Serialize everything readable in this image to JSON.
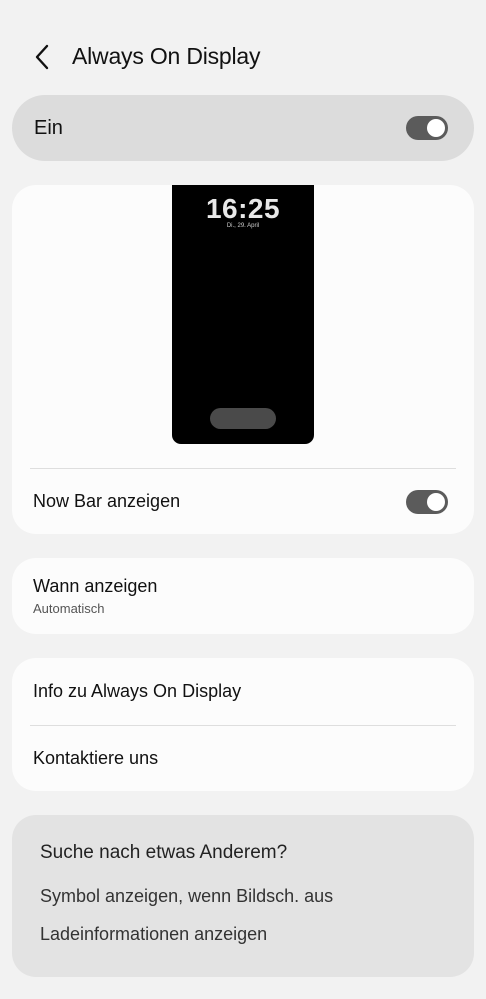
{
  "header": {
    "title": "Always On Display",
    "back_icon": "chevron-left-icon"
  },
  "master_switch": {
    "label": "Ein",
    "state": "on"
  },
  "preview": {
    "time": "16:25",
    "date": "Di., 29. April"
  },
  "now_bar": {
    "label": "Now Bar anzeigen",
    "state": "on"
  },
  "when_show": {
    "label": "Wann anzeigen",
    "value": "Automatisch"
  },
  "info_section": {
    "info_label": "Info zu Always On Display",
    "contact_label": "Kontaktiere uns"
  },
  "suggestions": {
    "title": "Suche nach etwas Anderem?",
    "items": [
      "Symbol anzeigen, wenn Bildsch. aus",
      "Ladeinformationen anzeigen"
    ]
  },
  "colors": {
    "background": "#f2f2f2",
    "card": "#fcfcfc",
    "master_row": "#dcdcdc",
    "toggle_track": "#5b5b5b",
    "suggest_card": "#e3e3e3"
  }
}
